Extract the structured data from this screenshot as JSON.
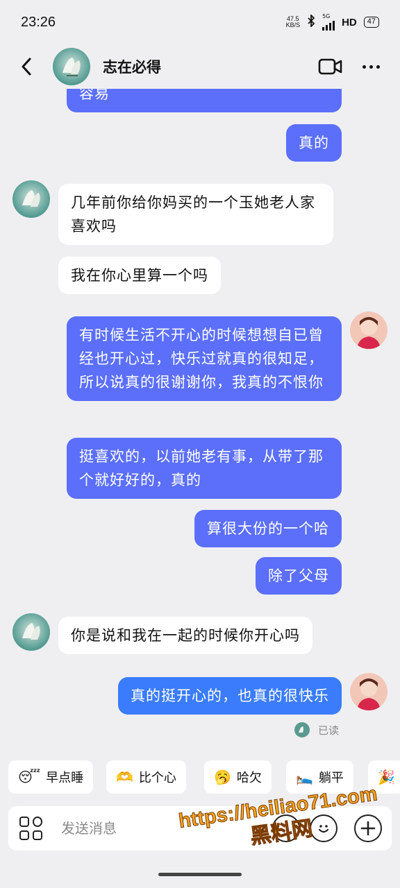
{
  "status_bar": {
    "time": "23:26",
    "net_speed_value": "47.5",
    "net_speed_unit": "KB/S",
    "network_type": "5G",
    "hd": "HD",
    "battery": "47"
  },
  "header": {
    "contact_name": "志在必得"
  },
  "messages": [
    {
      "side": "out",
      "text": "容易"
    },
    {
      "side": "out",
      "text": "真的"
    },
    {
      "side": "in",
      "text": "几年前你给你妈买的一个玉她老人家喜欢吗"
    },
    {
      "side": "in",
      "text": "我在你心里算一个吗"
    },
    {
      "side": "out",
      "text": "有时候生活不开心的时候想想自已曾经也开心过，快乐过就真的很知足，所以说真的很谢谢你，我真的不恨你"
    },
    {
      "side": "out",
      "text": "挺喜欢的，以前她老有事，从带了那个就好好的，真的"
    },
    {
      "side": "out",
      "text": "算很大份的一个哈"
    },
    {
      "side": "out",
      "text": "除了父母"
    },
    {
      "side": "in",
      "text": "你是说和我在一起的时候你开心吗"
    },
    {
      "side": "out",
      "text": "真的挺开心的，也真的很快乐"
    }
  ],
  "read_status": "已读",
  "quick_replies": [
    {
      "emoji": "😴",
      "label": "早点睡"
    },
    {
      "emoji": "🫶",
      "label": "比个心"
    },
    {
      "emoji": "🥱",
      "label": "哈欠"
    },
    {
      "emoji": "🛌",
      "label": "躺平"
    },
    {
      "emoji": "🎉",
      "label": ""
    }
  ],
  "input": {
    "placeholder": "发送消息"
  },
  "watermark": {
    "url": "https://heiliao71.com",
    "name": "黑料网"
  },
  "colors": {
    "outgoing_bubble": "#5b6ffb",
    "outgoing_bubble_latest": "#3a7cfb",
    "incoming_bubble": "#ffffff",
    "background": "#efeff1"
  }
}
